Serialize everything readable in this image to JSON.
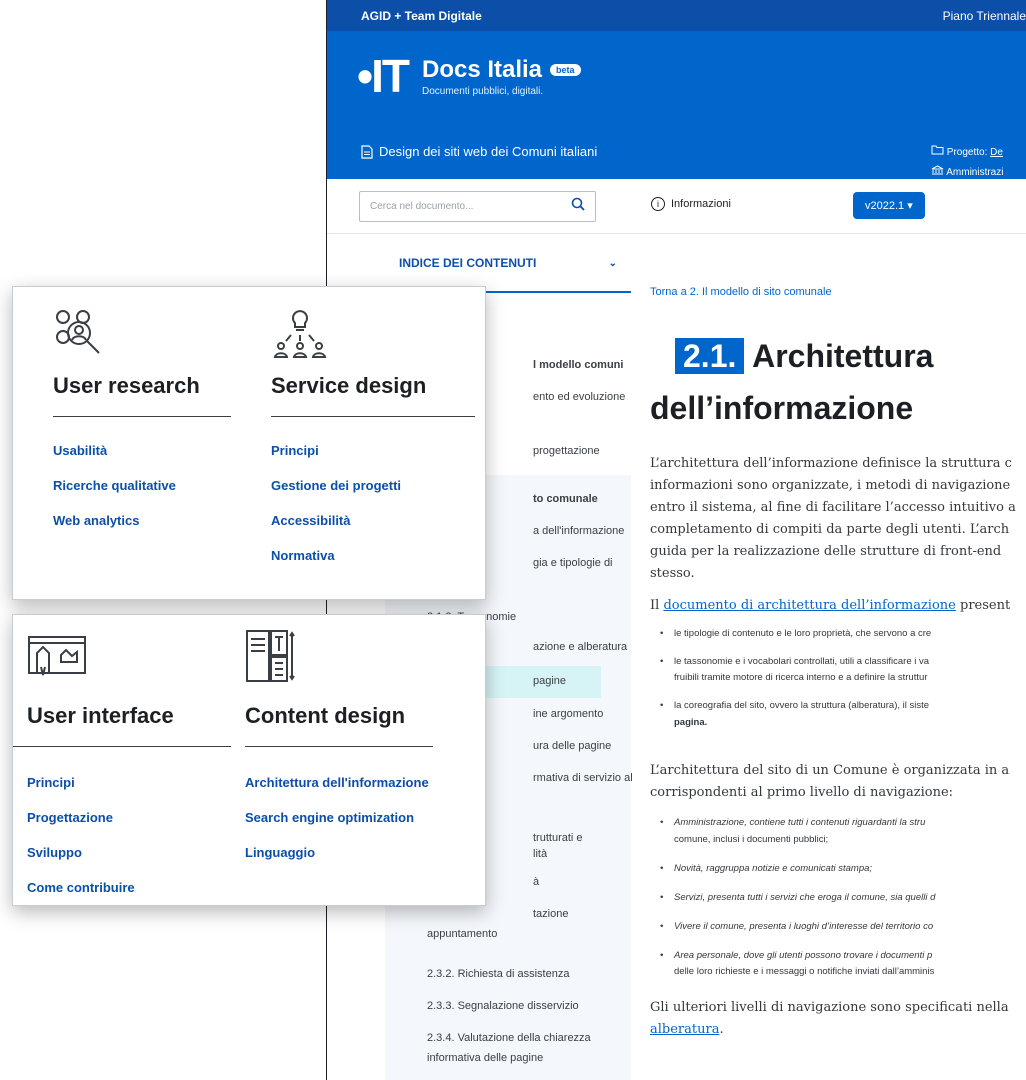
{
  "topbar": {
    "left": "AGID + Team Digitale",
    "right": "Piano Triennale"
  },
  "header": {
    "brand": "Docs Italia",
    "badge": "beta",
    "tagline": "Documenti pubblici, digitali.",
    "document": "Design dei siti web dei Comuni italiani",
    "project_prefix": "Progetto: ",
    "project_link": "De",
    "admin": "Amministrazi"
  },
  "toolbar": {
    "search_placeholder": "Cerca nel documento...",
    "info_label": "Informazioni",
    "version": "v2022.1"
  },
  "sidebar": {
    "index_title": "INDICE DEI CONTENUTI",
    "items": [
      "l modello comuni",
      "ento ed evoluzione",
      "progettazione",
      "to comunale",
      "a dell'informazione",
      "gia e tipologie di",
      "2.1.2. Tassonomie",
      "azione e alberatura",
      "pagine",
      "ine argomento",
      "ura delle pagine",
      "rmativa di servizio al",
      "trutturati e",
      "lità",
      "à",
      "tazione",
      "appuntamento",
      "2.3.2. Richiesta di assistenza",
      "2.3.3. Segnalazione disservizio",
      "2.3.4. Valutazione della chiarezza",
      "informativa delle pagine"
    ]
  },
  "content": {
    "breadcrumb": "Torna a 2. Il modello di sito comunale",
    "heading_num": "2.1.",
    "heading_1": "Architettura",
    "heading_2": "dell’informazione",
    "para1": [
      "L’architettura dell’informazione definisce la struttura c",
      "informazioni sono organizzate, i metodi di navigazione",
      "entro il sistema, al fine di facilitare l’accesso intuitivo a",
      "completamento di compiti da parte degli utenti. L’arch",
      "guida per la realizzazione delle strutture di front-end",
      "stesso."
    ],
    "para2_prefix": "Il ",
    "para2_link": "documento di architettura dell’informazione",
    "para2_suffix": " present",
    "bullets1": [
      "le tipologie di contenuto e le loro proprietà, che servono a cre",
      "le tassonomie e i vocabolari controllati, utili a classificare i va",
      "fruibili tramite motore di ricerca interno e a definire la struttur",
      "la coreografia del sito, ovvero la struttura (alberatura), il siste",
      "pagina."
    ],
    "para3": [
      "L’architettura del sito di un Comune è organizzata in a",
      "corrispondenti al primo livello di navigazione:"
    ],
    "bullets2": [
      "Amministrazione, contiene tutti i contenuti riguardanti la stru",
      "comune, inclusi i documenti pubblici;",
      "Novità, raggruppa notizie e comunicati stampa;",
      "Servizi, presenta tutti i servizi che eroga il comune, sia quelli d",
      "Vivere il comune, presenta i luoghi d’interesse del territorio co",
      "Area personale, dove gli utenti possono trovare i documenti p",
      "delle loro richieste e i messaggi o notifiche inviati dall’amminis"
    ],
    "para4": "Gli ulteriori livelli di navigazione sono specificati nella",
    "para4_link": "alberatura",
    "para4_end": "."
  },
  "cards": {
    "user_research": {
      "title": "User research",
      "links": [
        "Usabilità",
        "Ricerche qualitative",
        "Web analytics"
      ]
    },
    "service_design": {
      "title": "Service design",
      "links": [
        "Principi",
        "Gestione dei progetti",
        "Accessibilità",
        "Normativa"
      ]
    },
    "user_interface": {
      "title": "User interface",
      "links": [
        "Principi",
        "Progettazione",
        "Sviluppo",
        "Come contribuire"
      ]
    },
    "content_design": {
      "title": "Content design",
      "links": [
        "Architettura dell'informazione",
        "Search engine optimization",
        "Linguaggio"
      ]
    }
  },
  "colors": {
    "brand_blue": "#0066cc",
    "dark_blue": "#0b4fa8",
    "link": "#0b4fa8",
    "highlight": "#d6f4f6"
  }
}
